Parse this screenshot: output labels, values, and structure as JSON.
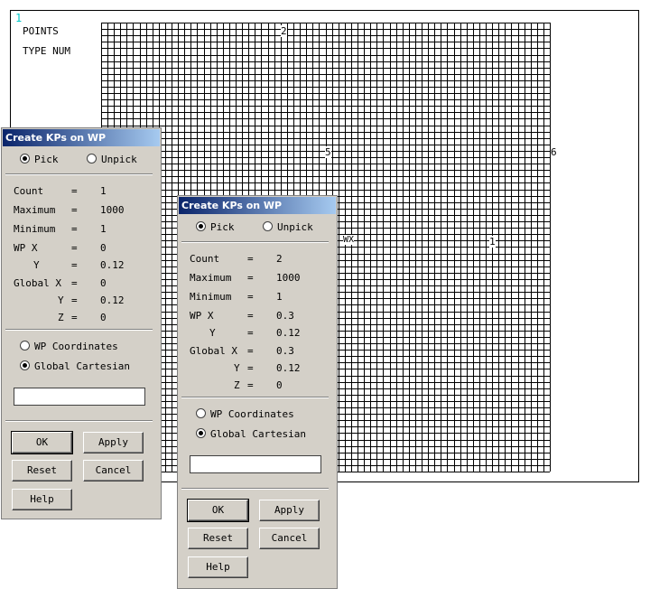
{
  "graphics": {
    "window_number": "1",
    "label_points": "POINTS",
    "label_type_num": "TYPE NUM",
    "kp_labels": [
      "2",
      "5",
      "6",
      "1"
    ],
    "wp_marker": "WX",
    "grid_color": "#000000",
    "window_number_color": "#00c8c8"
  },
  "dialogs": [
    {
      "title": "Create KPs on WP",
      "pick_label": "Pick",
      "unpick_label": "Unpick",
      "rows": [
        {
          "label": "Count",
          "value": "1"
        },
        {
          "label": "Maximum",
          "value": "1000"
        },
        {
          "label": "Minimum",
          "value": "1"
        },
        {
          "label": "WP X",
          "value": "0"
        },
        {
          "label": "Y",
          "value": "0.12"
        },
        {
          "label": "Global X",
          "value": "0"
        },
        {
          "label": "Y",
          "value": "0.12"
        },
        {
          "label": "Z",
          "value": "0"
        }
      ],
      "equals": "=",
      "wp_coordinates_label": "WP Coordinates",
      "global_cartesian_label": "Global Cartesian",
      "input_value": "",
      "ok_label": "OK",
      "apply_label": "Apply",
      "reset_label": "Reset",
      "cancel_label": "Cancel",
      "help_label": "Help"
    },
    {
      "title": "Create KPs on WP",
      "pick_label": "Pick",
      "unpick_label": "Unpick",
      "rows": [
        {
          "label": "Count",
          "value": "2"
        },
        {
          "label": "Maximum",
          "value": "1000"
        },
        {
          "label": "Minimum",
          "value": "1"
        },
        {
          "label": "WP X",
          "value": "0.3"
        },
        {
          "label": "Y",
          "value": "0.12"
        },
        {
          "label": "Global X",
          "value": "0.3"
        },
        {
          "label": "Y",
          "value": "0.12"
        },
        {
          "label": "Z",
          "value": "0"
        }
      ],
      "equals": "=",
      "wp_coordinates_label": "WP Coordinates",
      "global_cartesian_label": "Global Cartesian",
      "input_value": "",
      "ok_label": "OK",
      "apply_label": "Apply",
      "reset_label": "Reset",
      "cancel_label": "Cancel",
      "help_label": "Help"
    }
  ]
}
